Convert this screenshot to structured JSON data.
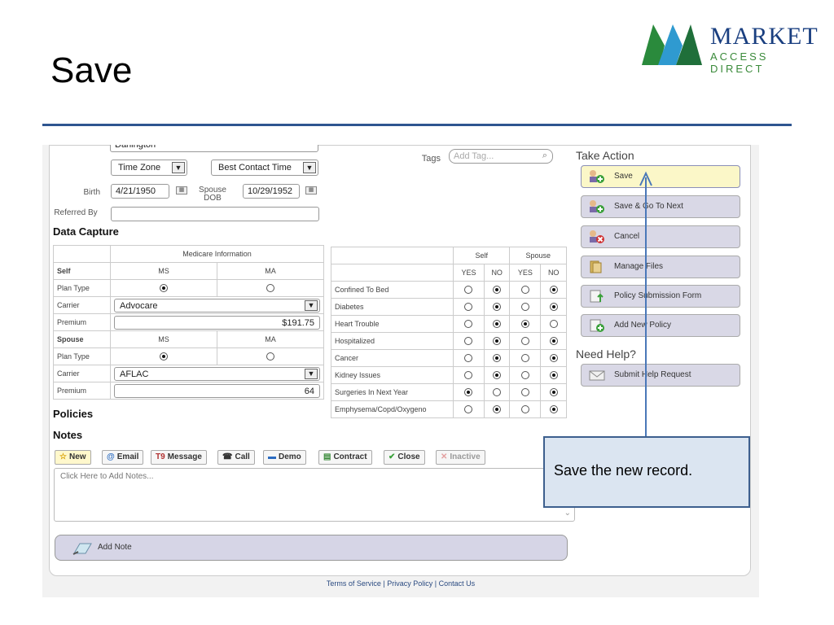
{
  "slide": {
    "title": "Save"
  },
  "logo": {
    "word1": "MARKET",
    "word2": "ACCESS DIRECT"
  },
  "form": {
    "county_value": "Darlington",
    "time_zone": "Time Zone",
    "best_contact_time": "Best Contact Time",
    "birth_label": "Birth",
    "birth_value": "4/21/1950",
    "spouse_dob_label": "Spouse DOB",
    "spouse_dob_value": "10/29/1952",
    "referred_by_label": "Referred By",
    "tags_label": "Tags",
    "tags_placeholder": "Add Tag..."
  },
  "data_capture": {
    "heading": "Data Capture",
    "medicare_header": "Medicare Information",
    "self_label": "Self",
    "ms": "MS",
    "ma": "MA",
    "plan_type": "Plan Type",
    "carrier": "Carrier",
    "premium": "Premium",
    "spouse_label": "Spouse",
    "self_carrier": "Advocare",
    "self_premium": "$191.75",
    "spouse_carrier": "AFLAC",
    "spouse_premium": "64",
    "self_plan": "MS",
    "spouse_plan": "MS"
  },
  "health": {
    "self_header": "Self",
    "spouse_header": "Spouse",
    "yes": "YES",
    "no": "NO",
    "rows": [
      {
        "label": "Confined To Bed",
        "self": "NO",
        "spouse": "NO"
      },
      {
        "label": "Diabetes",
        "self": "NO",
        "spouse": "NO"
      },
      {
        "label": "Heart Trouble",
        "self": "NO",
        "spouse": "YES"
      },
      {
        "label": "Hospitalized",
        "self": "NO",
        "spouse": "NO"
      },
      {
        "label": "Cancer",
        "self": "NO",
        "spouse": "NO"
      },
      {
        "label": "Kidney Issues",
        "self": "NO",
        "spouse": "NO"
      },
      {
        "label": "Surgeries In Next Year",
        "self": "YES",
        "spouse": "NO"
      },
      {
        "label": "Emphysema/Copd/Oxygeno",
        "self": "NO",
        "spouse": "NO"
      }
    ]
  },
  "sections": {
    "policies": "Policies",
    "notes": "Notes"
  },
  "notes_toolbar": {
    "new": "New",
    "email": "Email",
    "message": "Message",
    "call": "Call",
    "demo": "Demo",
    "contract": "Contract",
    "close": "Close",
    "inactive": "Inactive"
  },
  "notes": {
    "placeholder": "Click Here to Add Notes...",
    "add_note": "Add Note"
  },
  "take_action": {
    "heading": "Take Action",
    "save": "Save",
    "save_next": "Save & Go To Next",
    "cancel": "Cancel",
    "manage_files": "Manage Files",
    "policy_submission": "Policy Submission Form",
    "add_policy": "Add New Policy"
  },
  "help": {
    "heading": "Need Help?",
    "submit": "Submit Help Request"
  },
  "footer": {
    "text": "Terms of Service | Privacy Policy | Contact Us"
  },
  "annotation": {
    "text": "Save the new record."
  },
  "colors": {
    "rule": "#2e5590",
    "action_bg": "#d9d8e6",
    "save_highlight": "#fbf7c8",
    "callout_bg": "#dbe5f1"
  }
}
